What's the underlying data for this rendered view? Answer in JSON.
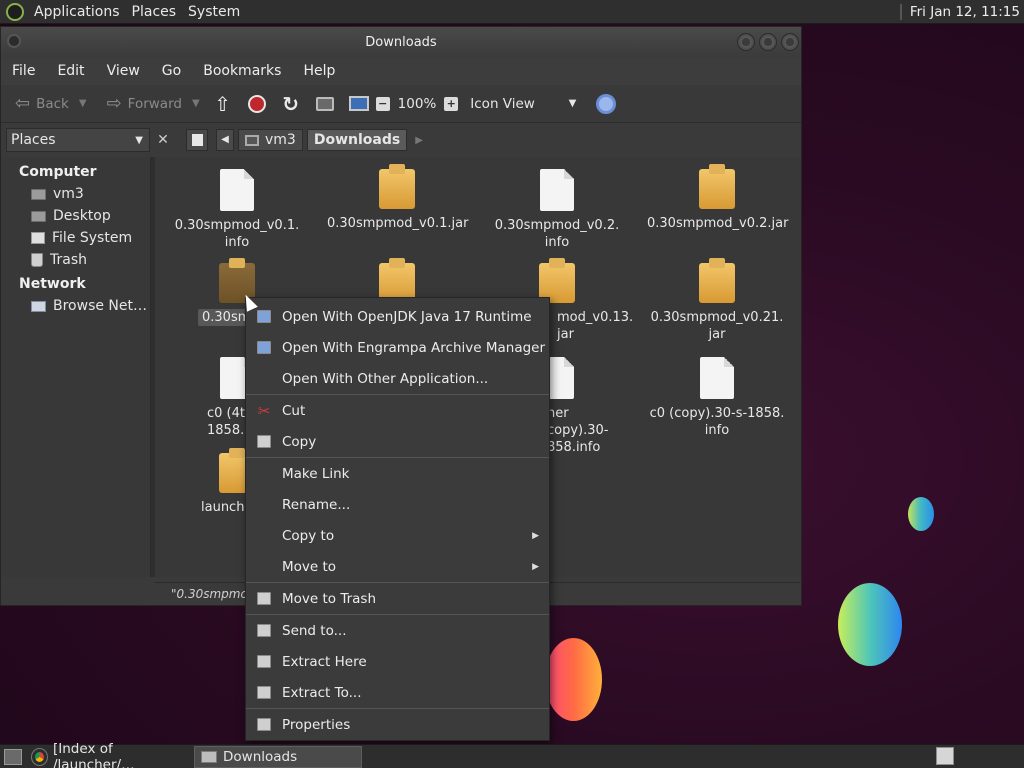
{
  "top_panel": {
    "menus": [
      "Applications",
      "Places",
      "System"
    ],
    "clock": "Fri Jan 12, 11:15"
  },
  "window": {
    "title": "Downloads",
    "menubar": [
      "File",
      "Edit",
      "View",
      "Go",
      "Bookmarks",
      "Help"
    ],
    "toolbar": {
      "back_label": "Back",
      "forward_label": "Forward",
      "zoom_level": "100%",
      "view_mode": "Icon View"
    },
    "location": {
      "side_pane_select": "Places",
      "crumbs": [
        "vm3",
        "Downloads"
      ]
    },
    "sidebar": {
      "computer_heading": "Computer",
      "computer_items": [
        "vm3",
        "Desktop",
        "File System",
        "Trash"
      ],
      "network_heading": "Network",
      "network_items": [
        "Browse Net…"
      ]
    },
    "files": [
      {
        "label": "0.30smpmod_v0.1.\ninfo",
        "type": "doc"
      },
      {
        "label": "0.30smpmod_v0.1.jar",
        "type": "jar"
      },
      {
        "label": "0.30smpmod_v0.2.\ninfo",
        "type": "doc"
      },
      {
        "label": "0.30smpmod_v0.2.jar",
        "type": "jar"
      },
      {
        "label": "0.30smpmo",
        "type": "jar-selected"
      },
      {
        "label": "",
        "type": "jar"
      },
      {
        "label": "mod_v0.13.\njar",
        "type": "jar"
      },
      {
        "label": "0.30smpmod_v0.21.\njar",
        "type": "jar"
      },
      {
        "label": "c0 (4th cop\n1858.",
        "type": "doc"
      },
      {
        "label": "",
        "type": "hidden"
      },
      {
        "label": "her copy).30-\n858.info",
        "type": "doc"
      },
      {
        "label": "c0 (copy).30-s-1858.\ninfo",
        "type": "doc"
      },
      {
        "label": "launcher-1.",
        "type": "jar"
      }
    ],
    "status": "\"0.30smpmod_"
  },
  "context_menu": {
    "items": [
      {
        "label": "Open With OpenJDK Java 17 Runtime",
        "icon": "java-icon"
      },
      {
        "label": "Open With Engrampa Archive Manager",
        "icon": "archive-manager-icon"
      },
      {
        "label": "Open With Other Application...",
        "icon": ""
      },
      {
        "label": "Cut",
        "icon": "scissors-icon"
      },
      {
        "label": "Copy",
        "icon": "copy-icon"
      },
      {
        "label": "Make Link",
        "icon": ""
      },
      {
        "label": "Rename...",
        "icon": ""
      },
      {
        "label": "Copy to",
        "icon": "",
        "submenu": true
      },
      {
        "label": "Move to",
        "icon": "",
        "submenu": true
      },
      {
        "label": "Move to Trash",
        "icon": "trash-icon"
      },
      {
        "label": "Send to...",
        "icon": "send-icon"
      },
      {
        "label": "Extract Here",
        "icon": "extract-icon"
      },
      {
        "label": "Extract To...",
        "icon": "extract-icon"
      },
      {
        "label": "Properties",
        "icon": "properties-icon"
      }
    ]
  },
  "taskbar": {
    "tasks": [
      "[Index of /launcher/…",
      "Downloads"
    ]
  }
}
